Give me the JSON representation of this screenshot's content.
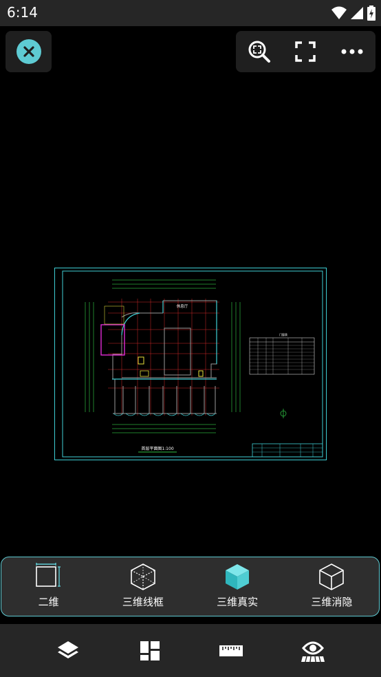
{
  "status": {
    "time": "6:14"
  },
  "drawing": {
    "hall_label": "休息厅",
    "plan_title": "首层平面图1:100",
    "table_title": "门窗表"
  },
  "view_modes": [
    {
      "label": "二维"
    },
    {
      "label": "三维线框"
    },
    {
      "label": "三维真实"
    },
    {
      "label": "三维消隐"
    }
  ],
  "colors": {
    "accent": "#5ecbd3",
    "background": "#000000",
    "bar": "#262626"
  }
}
